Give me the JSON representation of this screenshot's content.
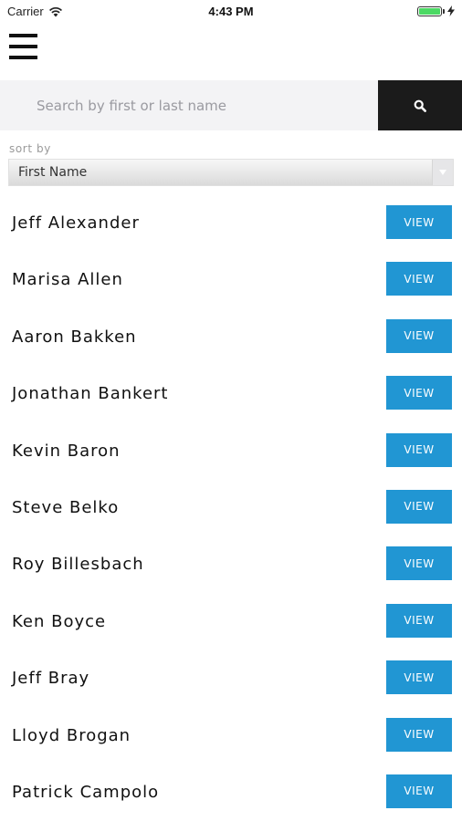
{
  "status_bar": {
    "carrier": "Carrier",
    "time": "4:43 PM",
    "icons": [
      "wifi-icon",
      "battery-icon",
      "charging-bolt-icon"
    ]
  },
  "header": {
    "menu_icon": "hamburger-menu-icon"
  },
  "search": {
    "placeholder": "Search by first or last name",
    "value": "",
    "button_icon": "search-icon"
  },
  "sort": {
    "label": "sort by",
    "selected": "First Name"
  },
  "colors": {
    "view_button": "#2196d3",
    "search_button": "#1b1b1b",
    "search_bar_bg": "#f3f3f5",
    "battery": "#4cd964"
  },
  "contacts": [
    {
      "name": "Jeff Alexander",
      "action": "VIEW"
    },
    {
      "name": "Marisa Allen",
      "action": "VIEW"
    },
    {
      "name": "Aaron Bakken",
      "action": "VIEW"
    },
    {
      "name": "Jonathan Bankert",
      "action": "VIEW"
    },
    {
      "name": "Kevin Baron",
      "action": "VIEW"
    },
    {
      "name": "Steve Belko",
      "action": "VIEW"
    },
    {
      "name": "Roy Billesbach",
      "action": "VIEW"
    },
    {
      "name": "Ken Boyce",
      "action": "VIEW"
    },
    {
      "name": "Jeff Bray",
      "action": "VIEW"
    },
    {
      "name": "Lloyd Brogan",
      "action": "VIEW"
    },
    {
      "name": "Patrick Campolo",
      "action": "VIEW"
    }
  ]
}
